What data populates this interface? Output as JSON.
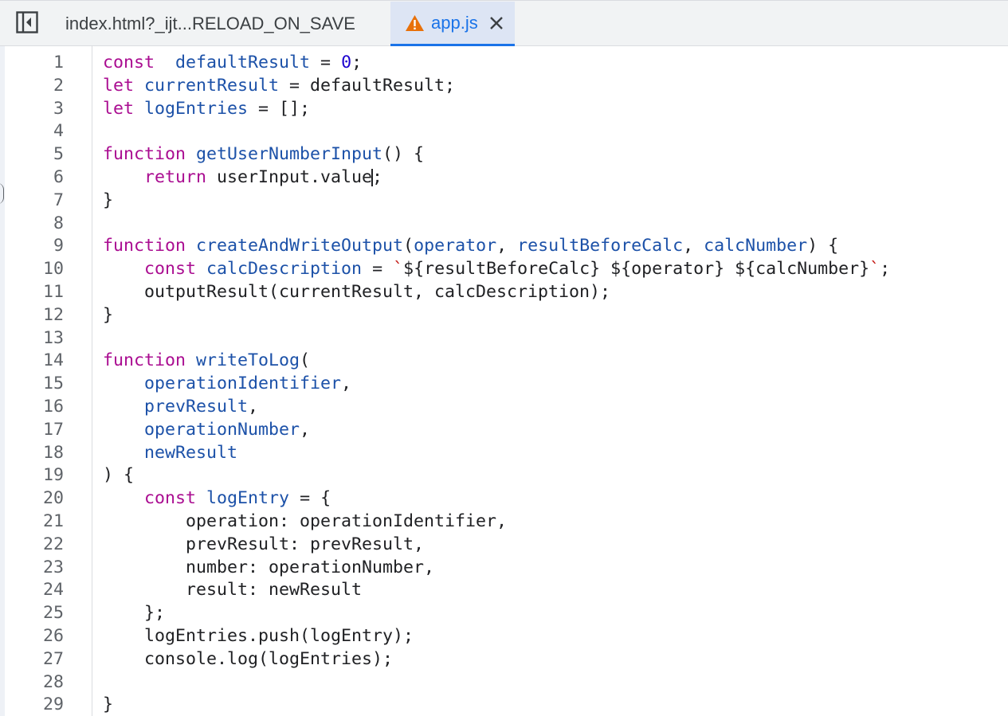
{
  "tabs": [
    {
      "label": "index.html?_ijt...RELOAD_ON_SAVE",
      "active": false
    },
    {
      "label": "app.js",
      "active": true,
      "warning": true
    }
  ],
  "icons": {
    "sidebar_toggle": "sidebar-toggle-icon",
    "warning": "warning-icon",
    "close": "close-icon"
  },
  "colors": {
    "accent": "#1a73e8",
    "warning": "#e8710a",
    "keyword": "#aa0d91",
    "definition": "#1c51a8"
  },
  "editor": {
    "cursor": {
      "line": 6,
      "column": 28
    },
    "lines": [
      {
        "n": "1",
        "tokens": [
          [
            "kw",
            "const"
          ],
          [
            "",
            "  "
          ],
          [
            "def",
            "defaultResult"
          ],
          [
            "",
            " = "
          ],
          [
            "num",
            "0"
          ],
          [
            "",
            ";"
          ]
        ]
      },
      {
        "n": "2",
        "tokens": [
          [
            "kw",
            "let"
          ],
          [
            "",
            " "
          ],
          [
            "def",
            "currentResult"
          ],
          [
            "",
            " = defaultResult;"
          ]
        ]
      },
      {
        "n": "3",
        "tokens": [
          [
            "kw",
            "let"
          ],
          [
            "",
            " "
          ],
          [
            "def",
            "logEntries"
          ],
          [
            "",
            " = [];"
          ]
        ]
      },
      {
        "n": "4",
        "tokens": []
      },
      {
        "n": "5",
        "tokens": [
          [
            "kw",
            "function"
          ],
          [
            "",
            " "
          ],
          [
            "def",
            "getUserNumberInput"
          ],
          [
            "",
            "() {"
          ]
        ]
      },
      {
        "n": "6",
        "tokens": [
          [
            "",
            "    "
          ],
          [
            "kw",
            "return"
          ],
          [
            "",
            " userInput.value"
          ],
          [
            "cursor",
            ""
          ],
          [
            "",
            ";"
          ]
        ]
      },
      {
        "n": "7",
        "tokens": [
          [
            "",
            "}"
          ]
        ]
      },
      {
        "n": "8",
        "tokens": []
      },
      {
        "n": "9",
        "tokens": [
          [
            "kw",
            "function"
          ],
          [
            "",
            " "
          ],
          [
            "def",
            "createAndWriteOutput"
          ],
          [
            "",
            "("
          ],
          [
            "def",
            "operator"
          ],
          [
            "",
            ", "
          ],
          [
            "def",
            "resultBeforeCalc"
          ],
          [
            "",
            ", "
          ],
          [
            "def",
            "calcNumber"
          ],
          [
            "",
            ") {"
          ]
        ]
      },
      {
        "n": "10",
        "tokens": [
          [
            "",
            "    "
          ],
          [
            "kw",
            "const"
          ],
          [
            "",
            " "
          ],
          [
            "def",
            "calcDescription"
          ],
          [
            "",
            " = "
          ],
          [
            "tick",
            "`"
          ],
          [
            "str",
            "${resultBeforeCalc} ${operator} ${calcNumber}"
          ],
          [
            "tick",
            "`"
          ],
          [
            "",
            ";"
          ]
        ]
      },
      {
        "n": "11",
        "tokens": [
          [
            "",
            "    outputResult(currentResult, calcDescription);"
          ]
        ]
      },
      {
        "n": "12",
        "tokens": [
          [
            "",
            "}"
          ]
        ]
      },
      {
        "n": "13",
        "tokens": []
      },
      {
        "n": "14",
        "tokens": [
          [
            "kw",
            "function"
          ],
          [
            "",
            " "
          ],
          [
            "def",
            "writeToLog"
          ],
          [
            "",
            "("
          ]
        ]
      },
      {
        "n": "15",
        "tokens": [
          [
            "",
            "    "
          ],
          [
            "def",
            "operationIdentifier"
          ],
          [
            "",
            ","
          ]
        ]
      },
      {
        "n": "16",
        "tokens": [
          [
            "",
            "    "
          ],
          [
            "def",
            "prevResult"
          ],
          [
            "",
            ","
          ]
        ]
      },
      {
        "n": "17",
        "tokens": [
          [
            "",
            "    "
          ],
          [
            "def",
            "operationNumber"
          ],
          [
            "",
            ","
          ]
        ]
      },
      {
        "n": "18",
        "tokens": [
          [
            "",
            "    "
          ],
          [
            "def",
            "newResult"
          ]
        ]
      },
      {
        "n": "19",
        "tokens": [
          [
            "",
            ") {"
          ]
        ]
      },
      {
        "n": "20",
        "tokens": [
          [
            "",
            "    "
          ],
          [
            "kw",
            "const"
          ],
          [
            "",
            " "
          ],
          [
            "def",
            "logEntry"
          ],
          [
            "",
            " = {"
          ]
        ]
      },
      {
        "n": "21",
        "tokens": [
          [
            "",
            "        operation: operationIdentifier,"
          ]
        ]
      },
      {
        "n": "22",
        "tokens": [
          [
            "",
            "        prevResult: prevResult,"
          ]
        ]
      },
      {
        "n": "23",
        "tokens": [
          [
            "",
            "        number: operationNumber,"
          ]
        ]
      },
      {
        "n": "24",
        "tokens": [
          [
            "",
            "        result: newResult"
          ]
        ]
      },
      {
        "n": "25",
        "tokens": [
          [
            "",
            "    };"
          ]
        ]
      },
      {
        "n": "26",
        "tokens": [
          [
            "",
            "    logEntries.push(logEntry);"
          ]
        ]
      },
      {
        "n": "27",
        "tokens": [
          [
            "",
            "    console.log(logEntries);"
          ]
        ]
      },
      {
        "n": "28",
        "tokens": []
      },
      {
        "n": "29",
        "tokens": [
          [
            "",
            "}"
          ]
        ]
      }
    ]
  }
}
